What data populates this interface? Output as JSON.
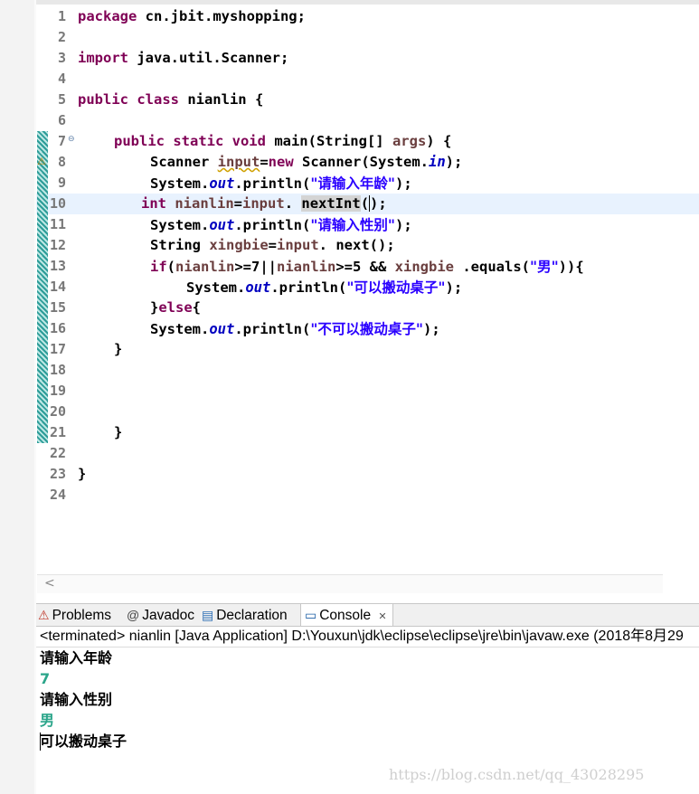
{
  "editor": {
    "lines": [
      {
        "n": "1"
      },
      {
        "n": "2"
      },
      {
        "n": "3"
      },
      {
        "n": "4"
      },
      {
        "n": "5"
      },
      {
        "n": "6"
      },
      {
        "n": "7"
      },
      {
        "n": "8"
      },
      {
        "n": "9"
      },
      {
        "n": "10"
      },
      {
        "n": "11"
      },
      {
        "n": "12"
      },
      {
        "n": "13"
      },
      {
        "n": "14"
      },
      {
        "n": "15"
      },
      {
        "n": "16"
      },
      {
        "n": "17"
      },
      {
        "n": "18"
      },
      {
        "n": "19"
      },
      {
        "n": "20"
      },
      {
        "n": "21"
      },
      {
        "n": "22"
      },
      {
        "n": "23"
      },
      {
        "n": "24"
      }
    ],
    "code": {
      "l1_kw": "package",
      "l1_rest": " cn.jbit.myshopping;",
      "l3_kw": "import",
      "l3_rest": " java.util.Scanner;",
      "l5_kw": "public class",
      "l5_rest": " nianlin {",
      "l7_kw1": "public static void",
      "l7_a": " main(String[] ",
      "l7_var": "args",
      "l7_b": ") {",
      "l8_a": "Scanner ",
      "l8_var": "input",
      "l8_b": "=",
      "l8_kw": "new",
      "l8_c": " Scanner(System.",
      "l8_fld": "in",
      "l8_d": ");",
      "l9_a": "System.",
      "l9_fld": "out",
      "l9_b": ".println(",
      "l9_str": "\"请输入年龄\"",
      "l9_c": ");",
      "l10_kw": "int",
      "l10_a": " ",
      "l10_var": "nianlin",
      "l10_b": "=",
      "l10_var2": "input",
      "l10_c": ". ",
      "l10_hl": "nextInt",
      "l10_d": "(",
      "l10_e": ");",
      "l11_a": "System.",
      "l11_fld": "out",
      "l11_b": ".println(",
      "l11_str": "\"请输入性别\"",
      "l11_c": ");",
      "l12_a": "String ",
      "l12_var": "xingbie",
      "l12_b": "=",
      "l12_var2": "input",
      "l12_c": ". next();",
      "l13_kw": "if",
      "l13_a": "(",
      "l13_var": "nianlin",
      "l13_b": ">=7||",
      "l13_var2": "nianlin",
      "l13_c": ">=5 && ",
      "l13_var3": "xingbie",
      "l13_d": " .equals(",
      "l13_str": "\"男\"",
      "l13_e": ")){",
      "l14_a": "System.",
      "l14_fld": "out",
      "l14_b": ".println(",
      "l14_str": "\"可以搬动桌子\"",
      "l14_c": ");",
      "l15_a": "}",
      "l15_kw": "else",
      "l15_b": "{",
      "l16_a": "System.",
      "l16_fld": "out",
      "l16_b": ".println(",
      "l16_str": "\"不可以搬动桌子\"",
      "l16_c": ");",
      "l17": "}",
      "l21": "}",
      "l23": "}"
    },
    "scroll_left_glyph": "<"
  },
  "console": {
    "tabs": [
      {
        "label": "Problems",
        "icon": "problems-icon",
        "glyph": "⚠"
      },
      {
        "label": "Javadoc",
        "icon": "at-icon",
        "glyph": "@"
      },
      {
        "label": "Declaration",
        "icon": "declaration-icon",
        "glyph": "▤"
      },
      {
        "label": "Console",
        "icon": "console-icon",
        "glyph": "▭",
        "close": "✕"
      }
    ],
    "description": "<terminated> nianlin [Java Application] D:\\Youxun\\jdk\\eclipse\\eclipse\\jre\\bin\\javaw.exe (2018年8月29",
    "output": [
      {
        "text": "请输入年龄",
        "kind": "stdout"
      },
      {
        "text": "7",
        "kind": "stdin"
      },
      {
        "text": "请输入性别",
        "kind": "stdout"
      },
      {
        "text": "男",
        "kind": "stdin"
      },
      {
        "text": "可以搬动桌子",
        "kind": "stdout"
      }
    ]
  },
  "watermark": "https://blog.csdn.net/qq_43028295",
  "colors": {
    "keyword": "#7f0055",
    "string": "#2a00ff",
    "field": "#0000c0",
    "variable": "#6a3e3e",
    "stdin": "#2ba58a",
    "current_line": "#e8f2fe"
  }
}
